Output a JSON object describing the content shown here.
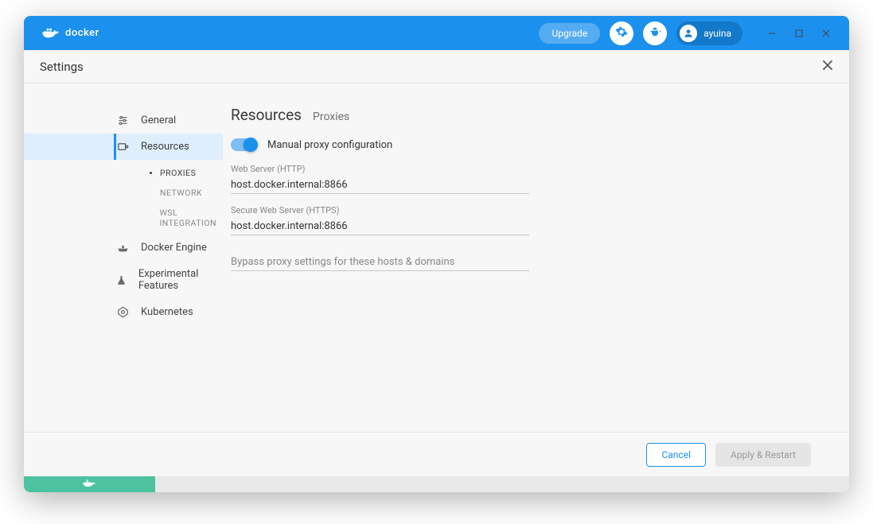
{
  "header": {
    "brand": "docker",
    "upgrade_label": "Upgrade",
    "username": "ayuina"
  },
  "page": {
    "title": "Settings"
  },
  "sidebar": {
    "items": [
      {
        "label": "General"
      },
      {
        "label": "Resources"
      },
      {
        "label": "Docker Engine"
      },
      {
        "label": "Experimental Features"
      },
      {
        "label": "Kubernetes"
      }
    ],
    "resources_sub": [
      {
        "label": "PROXIES"
      },
      {
        "label": "NETWORK"
      },
      {
        "label": "WSL INTEGRATION"
      }
    ]
  },
  "content": {
    "breadcrumb_main": "Resources",
    "breadcrumb_sub": "Proxies",
    "toggle_label": "Manual proxy configuration",
    "http_label": "Web Server (HTTP)",
    "http_value": "host.docker.internal:8866",
    "https_label": "Secure Web Server (HTTPS)",
    "https_value": "host.docker.internal:8866",
    "bypass_placeholder": "Bypass proxy settings for these hosts & domains"
  },
  "footer": {
    "cancel_label": "Cancel",
    "apply_label": "Apply & Restart"
  }
}
